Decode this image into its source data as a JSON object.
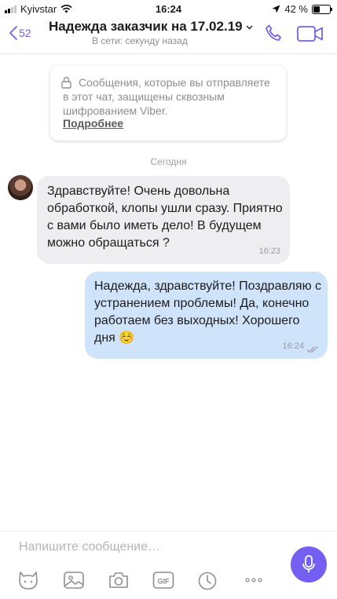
{
  "status_bar": {
    "carrier": "Kyivstar",
    "time": "16:24",
    "battery_percent": "42 %",
    "battery_level": 0.42
  },
  "header": {
    "back_count": "52",
    "title": "Надежда заказчик на 17.02.19",
    "subtitle": "В сети: секунду назад"
  },
  "notice": {
    "text": "Сообщения, которые вы отправляете в этот чат, защищены сквозным шифрованием Viber.",
    "link": "Подробнее"
  },
  "date_separator": "Сегодня",
  "messages": [
    {
      "direction": "incoming",
      "text": "Здравствуйте! Очень довольна обработкой, клопы ушли сразу. Приятно с вами было иметь дело! В будущем можно обращаться ?",
      "time": "16:23"
    },
    {
      "direction": "outgoing",
      "text": "Надежда, здравствуйте! Поздравляю с устранением проблемы! Да, конечно работаем без выходных! Хорошего дня ☺️",
      "time": "16:24"
    }
  ],
  "composer": {
    "placeholder": "Напишите сообщение…",
    "gif_label": "GIF"
  },
  "colors": {
    "accent": "#7360f2",
    "incoming_bubble": "#eeeef1",
    "outgoing_bubble": "#cfe3fb",
    "muted_text": "#8e8e93"
  },
  "icons": [
    "wifi-icon",
    "location-icon",
    "back-chevron-icon",
    "dropdown-chevron-icon",
    "phone-icon",
    "video-icon",
    "lock-icon",
    "read-ticks-icon",
    "microphone-icon",
    "sticker-icon",
    "gallery-icon",
    "camera-icon",
    "gif-icon",
    "timer-icon",
    "more-icon"
  ]
}
